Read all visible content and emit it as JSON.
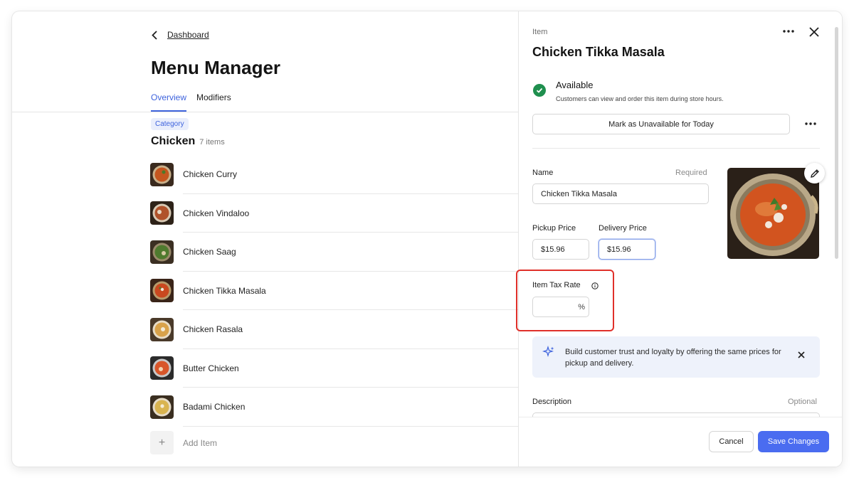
{
  "nav": {
    "back_label": "Dashboard"
  },
  "page": {
    "title": "Menu Manager"
  },
  "tabs": [
    {
      "label": "Overview",
      "active": true
    },
    {
      "label": "Modifiers",
      "active": false
    }
  ],
  "category": {
    "badge": "Category",
    "name": "Chicken",
    "count": "7 items",
    "items": [
      {
        "name": "Chicken Curry",
        "color": "#c4561f"
      },
      {
        "name": "Chicken Vindaloo",
        "color": "#b0522a"
      },
      {
        "name": "Chicken Saag",
        "color": "#4f7a2e"
      },
      {
        "name": "Chicken Tikka Masala",
        "color": "#c9481f"
      },
      {
        "name": "Chicken Rasala",
        "color": "#d9a24a"
      },
      {
        "name": "Butter Chicken",
        "color": "#d8562a"
      },
      {
        "name": "Badami Chicken",
        "color": "#d9b450"
      }
    ],
    "add_label": "Add Item"
  },
  "panel": {
    "eyebrow": "Item",
    "title": "Chicken Tikka Masala",
    "availability": {
      "title": "Available",
      "description": "Customers can view and order this item during store hours."
    },
    "unavailable_button": "Mark as Unavailable for Today",
    "name_field": {
      "label": "Name",
      "hint": "Required",
      "value": "Chicken Tikka Masala"
    },
    "pickup_price": {
      "label": "Pickup Price",
      "value": "$15.96"
    },
    "delivery_price": {
      "label": "Delivery Price",
      "value": "$15.96"
    },
    "tax_rate": {
      "label": "Item Tax Rate",
      "value": "",
      "suffix": "%"
    },
    "tip": {
      "text": "Build customer trust and loyalty by offering the same prices for pickup and delivery."
    },
    "description_field": {
      "label": "Description",
      "hint": "Optional"
    },
    "cancel_label": "Cancel",
    "save_label": "Save Changes"
  },
  "colors": {
    "accent": "#3e63dd",
    "primary_button": "#4a6cf0",
    "success": "#1f8f4e",
    "highlight": "#e0302a"
  }
}
